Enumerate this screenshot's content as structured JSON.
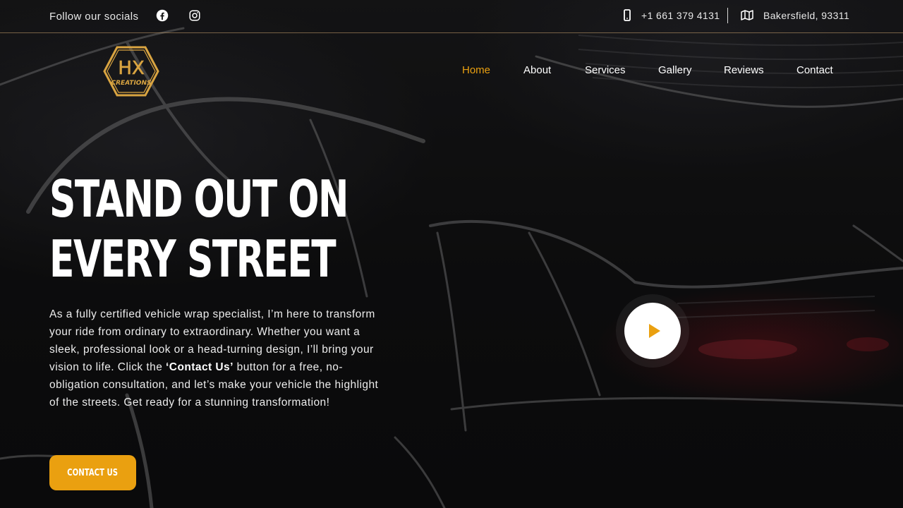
{
  "topbar": {
    "socials_label": "Follow our socials",
    "phone": "+1 661 379 4131",
    "address": "Bakersfield, 93311",
    "icons": [
      "facebook-icon",
      "instagram-icon",
      "phone-icon",
      "map-icon"
    ]
  },
  "brand": {
    "logo_text_top": "HX",
    "logo_text_bottom": "CREATIONS",
    "accent_color": "#eaa010",
    "logo_color": "#d9a441"
  },
  "nav": {
    "items": [
      {
        "label": "Home",
        "active": true
      },
      {
        "label": "About",
        "active": false
      },
      {
        "label": "Services",
        "active": false
      },
      {
        "label": "Gallery",
        "active": false
      },
      {
        "label": "Reviews",
        "active": false
      },
      {
        "label": "Contact",
        "active": false
      }
    ]
  },
  "hero": {
    "title_line1": "Stand out on",
    "title_line2": "every street",
    "body_part1": "As a fully certified vehicle wrap specialist, I’m here to transform your ride from ordinary to extraordinary. Whether you want a sleek, professional look or a head-turning design, I’ll bring your vision to life. Click the ",
    "body_bold": "‘Contact Us’",
    "body_part2": " button for a free, no-obligation consultation, and let’s make your vehicle the highlight of the streets. Get ready for a stunning transformation!",
    "cta_label": "CONTACT US"
  },
  "video": {
    "icon": "play-icon"
  }
}
